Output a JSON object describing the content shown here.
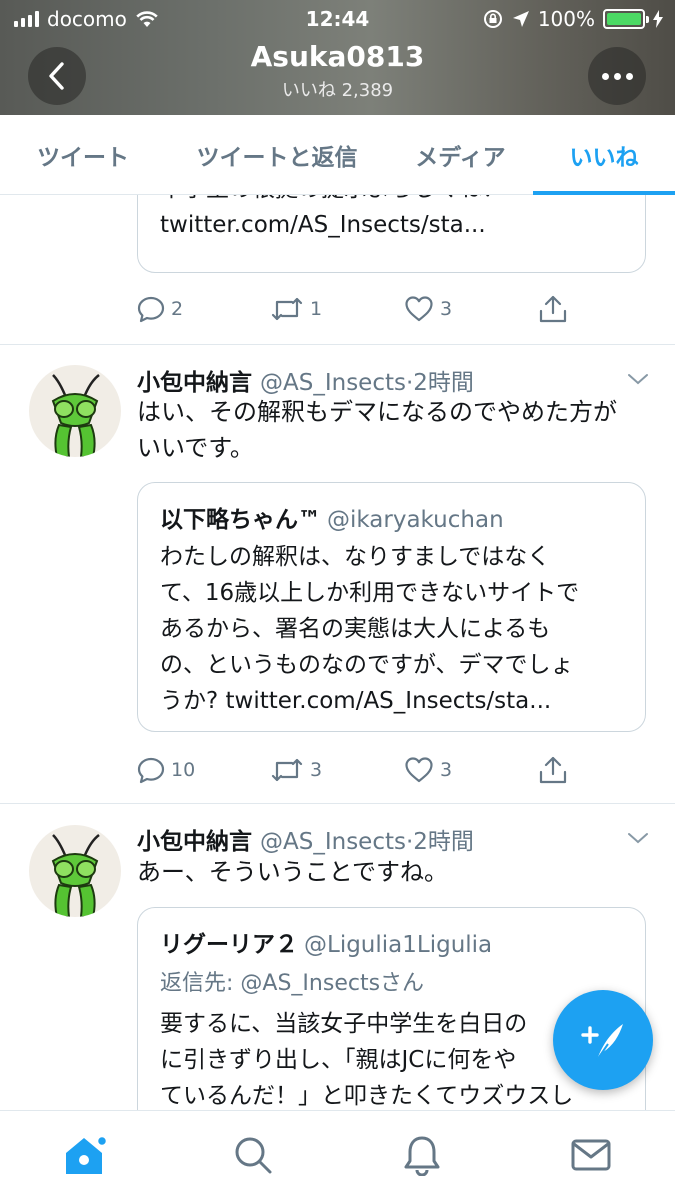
{
  "status_bar": {
    "carrier": "docomo",
    "time": "12:44",
    "battery": "100%"
  },
  "header": {
    "title": "Asuka0813",
    "subtitle": "いいね 2,389"
  },
  "tabs": [
    {
      "label": "ツイート",
      "active": false
    },
    {
      "label": "ツイートと返信",
      "active": false
    },
    {
      "label": "メディア",
      "active": false
    },
    {
      "label": "いいね",
      "active": true
    }
  ],
  "tweets": [
    {
      "quote": {
        "lines": [
          "中学生の根拠の提示よろしくね！",
          "twitter.com/AS_Insects/sta..."
        ]
      },
      "actions": {
        "replies": "2",
        "retweets": "1",
        "likes": "3"
      }
    },
    {
      "name": "小包中納言",
      "handle": "@AS_Insects",
      "time": "·2時間",
      "text_lines": [
        "はい、その解釈もデマになるのでやめた方が",
        "いいです。"
      ],
      "quote": {
        "name": "以下略ちゃん™",
        "handle": "@ikaryakuchan",
        "lines": [
          "わたしの解釈は、なりすましではなく",
          "て、16歳以上しか利用できないサイトで",
          "あるから、署名の実態は大人によるも",
          "の、というものなのですが、デマでしょ",
          "うか? twitter.com/AS_Insects/sta..."
        ]
      },
      "actions": {
        "replies": "10",
        "retweets": "3",
        "likes": "3"
      }
    },
    {
      "name": "小包中納言",
      "handle": "@AS_Insects",
      "time": "·2時間",
      "text_lines": [
        "あー、そういうことですね。"
      ],
      "quote": {
        "name": "リグーリア２",
        "handle": "@Ligulia1Ligulia",
        "reply_to": "返信先: @AS_Insectsさん",
        "lines": [
          "要するに、当該女子中学生を白日の",
          "に引きずり出し、「親はJCに何をや",
          "ているんだ！」と叩きたくてウズウスし"
        ]
      }
    }
  ],
  "colors": {
    "accent": "#1da1f2",
    "secondary_text": "#657786",
    "divider": "#e1e8ed"
  },
  "icons": {
    "back": "chevron-left-icon",
    "more": "more-dots-icon",
    "reply": "reply-icon",
    "retweet": "retweet-icon",
    "like": "heart-icon",
    "share": "share-icon",
    "compose": "compose-tweet-icon",
    "home": "home-icon",
    "search": "search-icon",
    "notifications": "bell-icon",
    "messages": "mail-icon"
  }
}
